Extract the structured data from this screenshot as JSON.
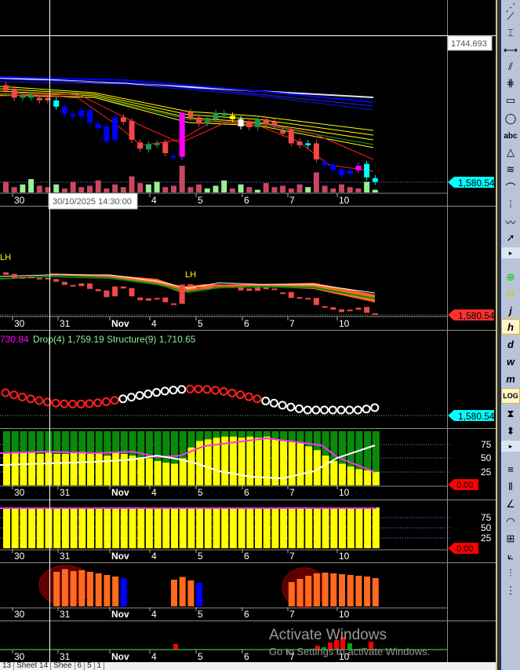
{
  "crosshair": {
    "price_label": "1744.693",
    "date_label": "30/10/2025 14:30:00"
  },
  "last_price_label": "1,580.54",
  "zero_label": "0.00",
  "x_axis": [
    "30",
    "31",
    "Nov",
    "4",
    "5",
    "6",
    "7",
    "10"
  ],
  "osc_levels": [
    "75",
    "50",
    "25"
  ],
  "pattern_labels": {
    "lh1": "LH",
    "lh2": "LH"
  },
  "panel3_title": {
    "part1": "730.84",
    "part2": "Drop(4) 1,759.19 Structure(9) 1,710.65"
  },
  "watermark": {
    "line1": "Activate Windows",
    "line2": "Go to Settings to activate Windows."
  },
  "sheet_tabs": [
    "13",
    "Sheet 14",
    "Shee",
    "6",
    "5",
    "1"
  ],
  "colors": {
    "up": "#1a9850",
    "down": "#f04848",
    "blue": "#0000ff",
    "cyan": "#00ffff",
    "magenta": "#ff00ff",
    "last": "#00ffff",
    "zero": "#ff0000"
  },
  "chart_data": {
    "type": "candlestick",
    "price_scale": {
      "crosshair": 1744.693,
      "last": 1580.54
    },
    "candles": [
      [
        1689,
        1683,
        "r"
      ],
      [
        1685,
        1675,
        "r"
      ],
      [
        1677,
        1675,
        "g"
      ],
      [
        1678,
        1675,
        "g"
      ],
      [
        1675,
        1672,
        "r"
      ],
      [
        1675,
        1672,
        "r"
      ],
      [
        1672,
        1665,
        "c"
      ],
      [
        1665,
        1657,
        "b"
      ],
      [
        1657,
        1654,
        "b"
      ],
      [
        1661,
        1654,
        "b"
      ],
      [
        1661,
        1647,
        "b"
      ],
      [
        1646,
        1641,
        "b"
      ],
      [
        1643,
        1626,
        "b"
      ],
      [
        1653,
        1628,
        "b"
      ],
      [
        1653,
        1648,
        "r"
      ],
      [
        1649,
        1628,
        "r"
      ],
      [
        1625,
        1618,
        "r"
      ],
      [
        1623,
        1617,
        "g"
      ],
      [
        1624,
        1622,
        "g"
      ],
      [
        1625,
        1613,
        "r"
      ],
      [
        1610,
        1608,
        "b"
      ],
      [
        1658,
        1609,
        "m"
      ],
      [
        1659,
        1653,
        "r"
      ],
      [
        1653,
        1646,
        "r"
      ],
      [
        1650,
        1646,
        "g"
      ],
      [
        1658,
        1651,
        "g"
      ],
      [
        1658,
        1655,
        "g"
      ],
      [
        1655,
        1651,
        "y"
      ],
      [
        1651,
        1643,
        "w"
      ],
      [
        1648,
        1642,
        "r"
      ],
      [
        1651,
        1642,
        "g"
      ],
      [
        1651,
        1646,
        "r"
      ],
      [
        1648,
        1644,
        "r"
      ],
      [
        1638,
        1635,
        "r"
      ],
      [
        1639,
        1624,
        "r"
      ],
      [
        1626,
        1622,
        "r"
      ],
      [
        1624,
        1622,
        "c"
      ],
      [
        1624,
        1606,
        "r"
      ],
      [
        1603,
        1600,
        "b"
      ],
      [
        1600,
        1594,
        "b"
      ],
      [
        1595,
        1588,
        "b"
      ],
      [
        1594,
        1590,
        "b"
      ],
      [
        1599,
        1594,
        "m"
      ],
      [
        1601,
        1586,
        "c"
      ],
      [
        1585,
        1581,
        "c"
      ]
    ],
    "volume": [
      8,
      4,
      6,
      10,
      5,
      4,
      6,
      3,
      8,
      4,
      5,
      9,
      3,
      6,
      4,
      12,
      7,
      6,
      8,
      4,
      5,
      20,
      4,
      6,
      3,
      5,
      9,
      3,
      6,
      4,
      2,
      7,
      4,
      5,
      3,
      6,
      4,
      15,
      5,
      3,
      6,
      4,
      3,
      8,
      2
    ],
    "osc1_yellow": [
      60,
      60,
      62,
      60,
      58,
      60,
      58,
      58,
      60,
      62,
      58,
      60,
      55,
      60,
      58,
      55,
      52,
      50,
      45,
      42,
      40,
      50,
      70,
      82,
      85,
      88,
      90,
      90,
      88,
      90,
      88,
      90,
      85,
      82,
      80,
      78,
      72,
      65,
      55,
      45,
      40,
      35,
      30,
      28,
      25
    ],
    "osc2_yellow": [
      100,
      100,
      100,
      100,
      100,
      100,
      100,
      100,
      100,
      100,
      100,
      100,
      100,
      100,
      100,
      100,
      100,
      100,
      100,
      100,
      100,
      100,
      100,
      100,
      100,
      100,
      100,
      100,
      100,
      100,
      100,
      100,
      100,
      100,
      100,
      100,
      100,
      100,
      100,
      100,
      100,
      100,
      100,
      100,
      100
    ],
    "osc3_bars": [
      0,
      0,
      0,
      0,
      0,
      0,
      88,
      95,
      90,
      92,
      88,
      84,
      80,
      76,
      -72,
      0,
      0,
      0,
      0,
      0,
      68,
      75,
      66,
      -60,
      0,
      0,
      0,
      0,
      0,
      0,
      0,
      0,
      0,
      0,
      62,
      70,
      78,
      84,
      86,
      84,
      82,
      80,
      78,
      76,
      72
    ]
  }
}
